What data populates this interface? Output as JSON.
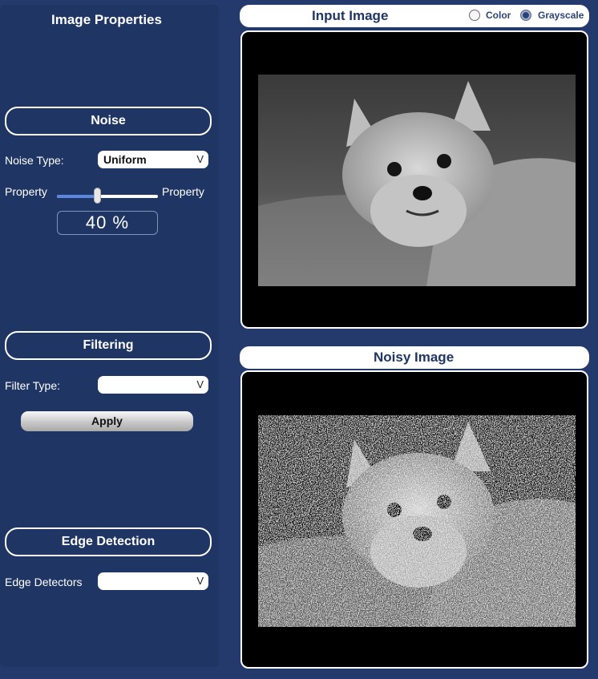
{
  "sidebar": {
    "title": "Image Properties",
    "noise": {
      "header": "Noise",
      "type_label": "Noise Type:",
      "type_value": "Uniform",
      "slider_left_label": "Property",
      "slider_right_label": "Property",
      "slider_value_fraction": 0.4,
      "percent_text": "40 %"
    },
    "filtering": {
      "header": "Filtering",
      "type_label": "Filter Type:",
      "type_value": "",
      "apply_label": "Apply"
    },
    "edge": {
      "header": "Edge Detection",
      "label": "Edge Detectors",
      "value": ""
    },
    "dropdown_glyph": "V"
  },
  "input_panel": {
    "title": "Input Image",
    "radio_color_label": "Color",
    "radio_grayscale_label": "Grayscale",
    "selected_mode": "Grayscale"
  },
  "noisy_panel": {
    "title": "Noisy Image"
  },
  "colors": {
    "background": "#253a6c",
    "sidebar": "#1f3563",
    "slider_fill": "#5b86e0",
    "title_text": "#1f3563"
  }
}
